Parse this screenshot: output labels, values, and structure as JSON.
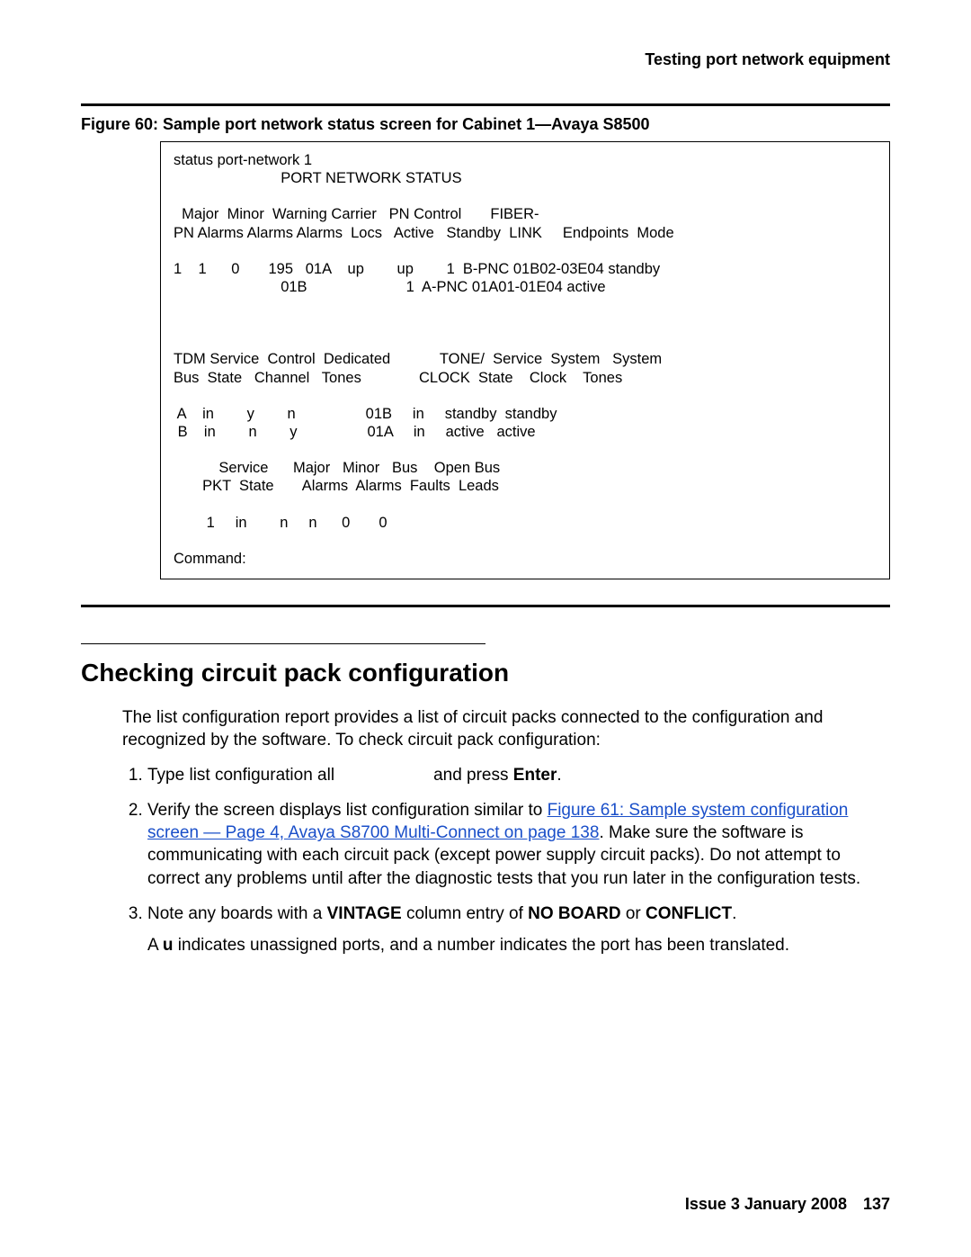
{
  "running_head": "Testing port network equipment",
  "figure_caption": "Figure 60: Sample port network status screen for Cabinet 1—Avaya S8500",
  "screen": {
    "cmd": "status port-network 1",
    "title": "PORT NETWORK STATUS",
    "hdr1a": "  Major  Minor  Warning Carrier   PN Control       FIBER-",
    "hdr1b": "PN Alarms Alarms Alarms  Locs   Active   Standby  LINK     Endpoints  Mode",
    "row1": "1    1      0       195   01A    up        up        1  B-PNC 01B02-03E04 standby",
    "row2": "                          01B                        1  A-PNC 01A01-01E04 active",
    "hdr2a": "TDM Service  Control  Dedicated            TONE/  Service  System   System",
    "hdr2b": "Bus  State   Channel   Tones              CLOCK  State    Clock    Tones",
    "row3": " A    in        y        n                 01B     in     standby  standby",
    "row4": " B    in        n        y                 01A     in     active   active",
    "hdr3a": "           Service      Major   Minor   Bus    Open Bus",
    "hdr3b": "       PKT  State       Alarms  Alarms  Faults  Leads",
    "row5": "        1     in        n     n      0       0",
    "prompt": "Command:"
  },
  "section_heading": "Checking circuit pack configuration",
  "intro_para": "The list configuration report provides a list of circuit packs connected to the configuration and recognized by the software. To check circuit pack configuration:",
  "steps": {
    "s1_a": "Type list configuration all",
    "s1_b": "and press ",
    "s1_enter": "Enter",
    "s1_c": ".",
    "s2_a": "Verify the screen displays list configuration similar to ",
    "s2_link": "Figure 61:  Sample system configuration screen — Page 4, Avaya S8700 Multi-Connect on page 138",
    "s2_b": ". Make sure the software is communicating with each circuit pack (except power supply circuit packs). Do not attempt to correct any problems until after the diagnostic tests that you run later in the configuration tests.",
    "s3_a": "Note any boards with a ",
    "s3_vintage": "VINTAGE",
    "s3_b": " column entry of ",
    "s3_noboard": "NO BOARD",
    "s3_c": " or ",
    "s3_conflict": "CONFLICT",
    "s3_d": ".",
    "s3_note_a": "A ",
    "s3_u": "u",
    "s3_note_b": " indicates unassigned ports, and a number indicates the port has been translated."
  },
  "footer": {
    "issue": "Issue 3   January 2008",
    "page": "137"
  }
}
